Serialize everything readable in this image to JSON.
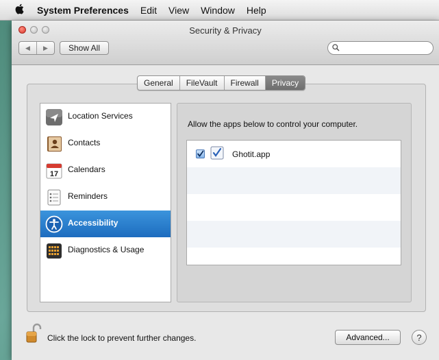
{
  "menubar": {
    "apple_icon": "apple-icon",
    "app_name": "System Preferences",
    "items": [
      "Edit",
      "View",
      "Window",
      "Help"
    ]
  },
  "window": {
    "title": "Security & Privacy",
    "nav_back": "◀",
    "nav_forward": "▶",
    "show_all": "Show All",
    "search_placeholder": ""
  },
  "tabs": [
    {
      "label": "General",
      "active": false
    },
    {
      "label": "FileVault",
      "active": false
    },
    {
      "label": "Firewall",
      "active": false
    },
    {
      "label": "Privacy",
      "active": true
    }
  ],
  "categories": [
    {
      "label": "Location Services",
      "icon": "location-icon",
      "selected": false
    },
    {
      "label": "Contacts",
      "icon": "contacts-icon",
      "selected": false
    },
    {
      "label": "Calendars",
      "icon": "calendar-icon",
      "selected": false,
      "icon_text": "17"
    },
    {
      "label": "Reminders",
      "icon": "reminders-icon",
      "selected": false
    },
    {
      "label": "Accessibility",
      "icon": "accessibility-icon",
      "selected": true
    },
    {
      "label": "Diagnostics & Usage",
      "icon": "diagnostics-icon",
      "selected": false
    }
  ],
  "privacy_pane": {
    "description": "Allow the apps below to control your computer.",
    "apps": [
      {
        "name": "Ghotit.app",
        "checked": true,
        "icon": "ghotit-app-icon"
      }
    ]
  },
  "footer": {
    "lock_text": "Click the lock to prevent further changes.",
    "lock_state": "unlocked",
    "advanced_button": "Advanced...",
    "help_button": "?"
  },
  "colors": {
    "selection": "#2a7ccd",
    "close_button": "#d9342b"
  }
}
